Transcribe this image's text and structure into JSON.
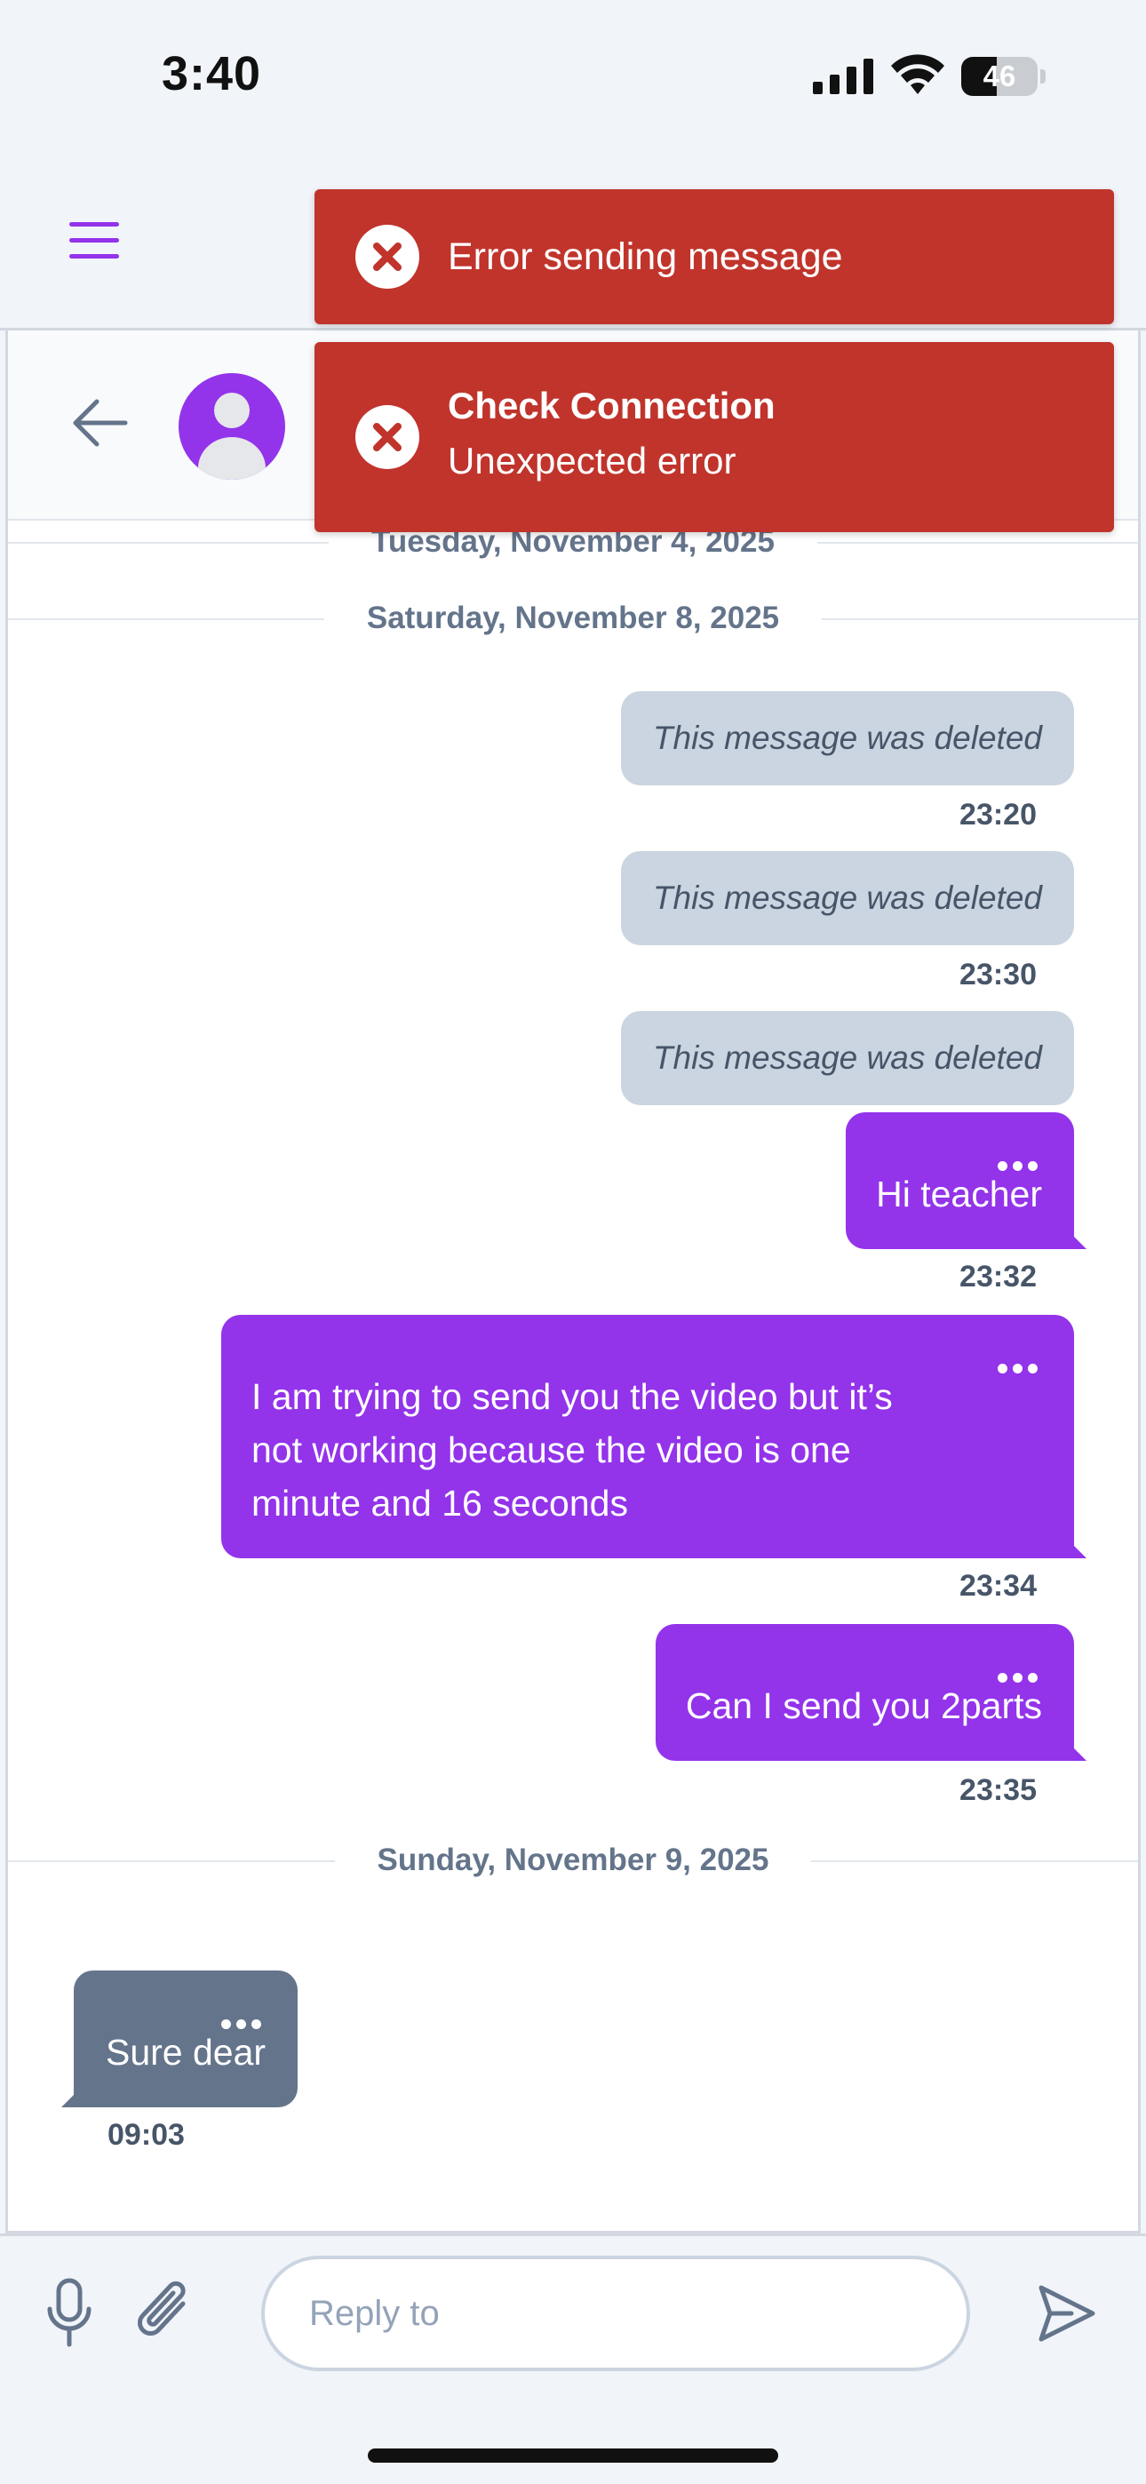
{
  "status_bar": {
    "time": "3:40",
    "battery": "46",
    "battery_level": 0.46
  },
  "icons": {
    "menu": "hamburger-menu-icon",
    "back": "arrow-left-icon",
    "avatar": "user-avatar-icon",
    "more": "ellipsis-icon",
    "mic": "microphone-icon",
    "attach": "paperclip-icon",
    "send": "send-icon",
    "error": "error-x-icon"
  },
  "colors": {
    "accent": "#9333ea",
    "incoming_bubble": "#64748b",
    "deleted_bubble": "#cbd5e1",
    "toast_error": "#c0342c"
  },
  "toasts": [
    {
      "message": "Error sending message"
    },
    {
      "title": "Check Connection",
      "message": "Unexpected error"
    }
  ],
  "chat": {
    "date_separators": [
      "Tuesday, November 4, 2025",
      "Saturday, November 8, 2025",
      "Sunday, November 9, 2025"
    ],
    "messages": [
      {
        "direction": "out",
        "deleted": true,
        "text": "This message was deleted",
        "time": "23:20"
      },
      {
        "direction": "out",
        "deleted": true,
        "text": "This message was deleted",
        "time": "23:30"
      },
      {
        "direction": "out",
        "deleted": true,
        "text": "This message was deleted",
        "time": ""
      },
      {
        "direction": "out",
        "deleted": false,
        "text": "Hi teacher",
        "time": "23:32"
      },
      {
        "direction": "out",
        "deleted": false,
        "text_lines": [
          "I am trying to send you the video but it’s",
          "not working because the video is one",
          "minute and 16 seconds"
        ],
        "time": "23:34"
      },
      {
        "direction": "out",
        "deleted": false,
        "text": "Can I send you 2parts",
        "time": "23:35"
      },
      {
        "direction": "in",
        "deleted": false,
        "text": "Sure dear",
        "time": "09:03"
      }
    ]
  },
  "composer": {
    "placeholder": "Reply to"
  }
}
